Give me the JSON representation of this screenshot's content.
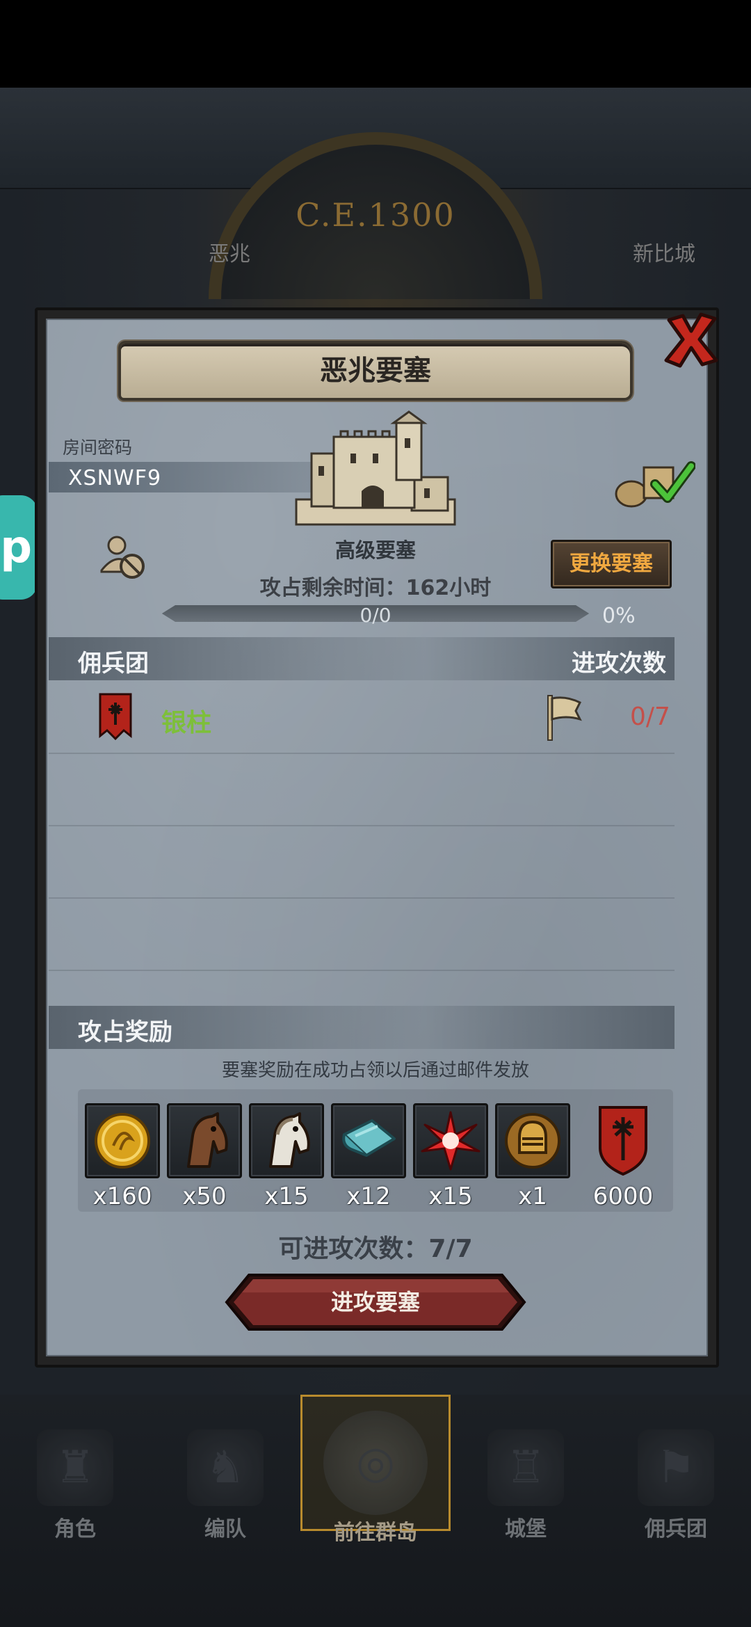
{
  "world": {
    "era": "C.E.1300",
    "left_city": "恶兆",
    "right_city": "新比城",
    "side_badge": "p"
  },
  "dialog": {
    "title": "恶兆要塞",
    "room_label": "房间密码",
    "room_code": "XSNWF9",
    "fortress_grade": "高级要塞",
    "change_button": "更换要塞",
    "remaining_time": "攻占剩余时间：162小时",
    "progress_text": "0/0",
    "progress_percent": "0%",
    "progress_fraction": 0,
    "mercenary_header": "佣兵团",
    "attacks_header": "进攻次数",
    "mercenaries": [
      {
        "name": "银柱",
        "attacks": "0/7"
      }
    ],
    "reward_header": "攻占奖励",
    "reward_note": "要塞奖励在成功占领以后通过邮件发放",
    "rewards": [
      {
        "icon": "gold-coin-icon",
        "qty": "x160"
      },
      {
        "icon": "brown-horse-icon",
        "qty": "x50"
      },
      {
        "icon": "white-horse-icon",
        "qty": "x15"
      },
      {
        "icon": "cloth-roll-icon",
        "qty": "x12"
      },
      {
        "icon": "red-star-icon",
        "qty": "x15"
      },
      {
        "icon": "knight-helmet-icon",
        "qty": "x1"
      },
      {
        "icon": "guild-banner-icon",
        "qty": "6000"
      }
    ],
    "attempts": "可进攻次数：7/7",
    "attack_button": "进攻要塞"
  },
  "nav": [
    {
      "label": "角色",
      "icon": "character-icon"
    },
    {
      "label": "编队",
      "icon": "formation-icon"
    },
    {
      "label": "前往群岛",
      "icon": "islands-compass-icon"
    },
    {
      "label": "城堡",
      "icon": "castle-icon"
    },
    {
      "label": "佣兵团",
      "icon": "mercenary-icon"
    }
  ],
  "colors": {
    "panel": "#8f9aa5",
    "accent_orange": "#f0a840",
    "merc_green": "#7dbf3a",
    "attack_red": "#c4504a",
    "button_red": "#7a2a28"
  }
}
